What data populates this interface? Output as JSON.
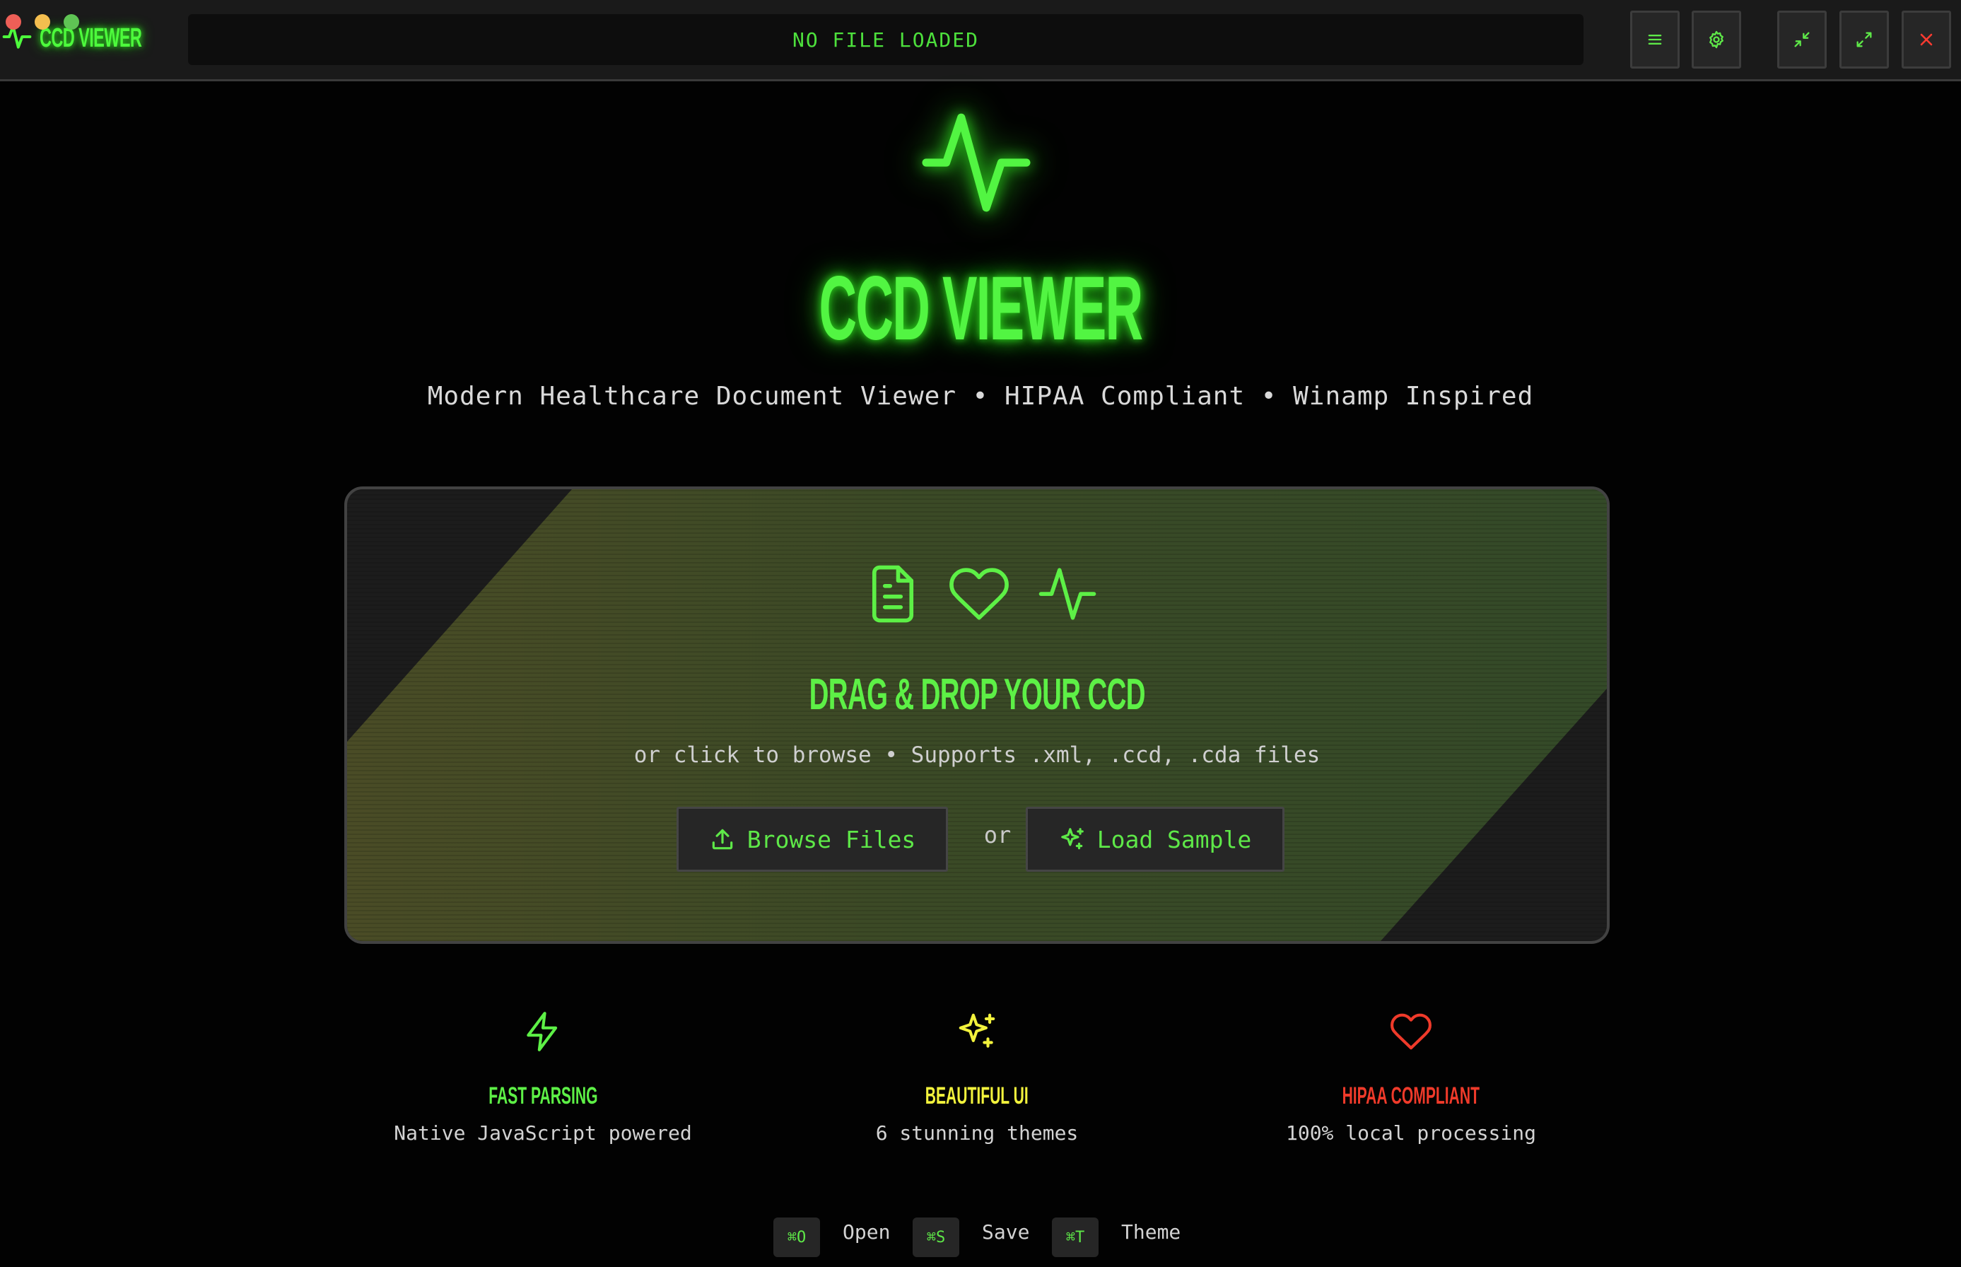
{
  "window": {
    "title": "CCD VIEWER",
    "status_text": "NO FILE LOADED"
  },
  "toolbar": {
    "buttons": [
      {
        "name": "menu",
        "icon": "menu-icon"
      },
      {
        "name": "settings",
        "icon": "gear-icon"
      },
      {
        "name": "minimize",
        "icon": "minimize-icon"
      },
      {
        "name": "maximize",
        "icon": "maximize-icon"
      },
      {
        "name": "close",
        "icon": "close-icon"
      }
    ]
  },
  "hero": {
    "icon": "activity-pulse-icon",
    "title": "CCD VIEWER",
    "subtitle": "Modern Healthcare Document Viewer • HIPAA Compliant • Winamp Inspired"
  },
  "dropzone": {
    "icons": [
      "file-text-icon",
      "heart-icon",
      "activity-pulse-icon"
    ],
    "title": "DRAG & DROP YOUR CCD",
    "subtitle": "or click to browse • Supports .xml, .ccd, .cda files",
    "browse_label": "Browse Files",
    "or_label": "or",
    "sample_label": "Load Sample"
  },
  "features": [
    {
      "icon": "lightning-icon",
      "title": "FAST PARSING",
      "description": "Native JavaScript powered",
      "color": "#5df046"
    },
    {
      "icon": "sparkles-icon",
      "title": "BEAUTIFUL UI",
      "description": "6 stunning themes",
      "color": "#f2f23c"
    },
    {
      "icon": "heart-icon",
      "title": "HIPAA COMPLIANT",
      "description": "100% local processing",
      "color": "#ef3a2a"
    }
  ],
  "shortcuts": [
    {
      "key": "⌘O",
      "label": "Open"
    },
    {
      "key": "⌘S",
      "label": "Save"
    },
    {
      "key": "⌘T",
      "label": "Theme"
    }
  ],
  "colors": {
    "accent": "#52f542",
    "background": "#020202",
    "titlebar": "#1a1a1a",
    "close": "#ff3b30"
  }
}
